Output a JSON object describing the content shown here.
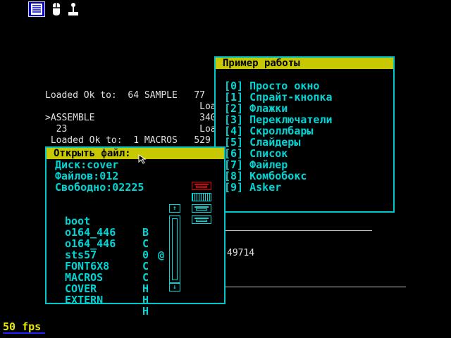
{
  "top_icons": [
    "menu-icon",
    "mouse-icon",
    "joystick-icon"
  ],
  "console": {
    "lines": [
      {
        "text": "Loaded Ok to:  64 SAMPLE   77",
        "row": 0
      },
      {
        "text": "                            Loa",
        "row": 1
      },
      {
        "text": ">ASSEMBLE                   340",
        "row": 2
      },
      {
        "text": "  23                        Loa",
        "row": 3
      },
      {
        "text": " Loaded Ok to:  1 MACROS   529",
        "row": 4
      }
    ],
    "number": "49714"
  },
  "example_window": {
    "title": "Пример работы",
    "items": [
      "[0] Просто окно",
      "[1] Спрайт-кнопка",
      "[2] Флажки",
      "[3] Переключатели",
      "[4] Скроллбары",
      "[5] Слайдеры",
      "[6] Список",
      "[7] Файлер",
      "[8] Комбобокс",
      "[9] Asker"
    ]
  },
  "open_file_window": {
    "title": "Открыть файл:",
    "disk": "Диск:cover",
    "files_count": "Файлов:012",
    "free": "Свободно:02225",
    "files": [
      {
        "name": "boot",
        "attr": "B"
      },
      {
        "name": "o164_446",
        "attr": "C"
      },
      {
        "name": "o164_446",
        "attr": "0"
      },
      {
        "name": "sts57",
        "attr": "C"
      },
      {
        "name": "FONT6X8",
        "attr": "C"
      },
      {
        "name": "MACROS",
        "attr": "H"
      },
      {
        "name": "COVER",
        "attr": "H"
      },
      {
        "name": "EXTERN",
        "attr": "H"
      }
    ],
    "selected_marker": "@",
    "scroll_up": "↑",
    "scroll_down": "↓",
    "colors": {
      "title_bg": "#c8c800",
      "border": "#00c8c8",
      "text": "#00d4d4",
      "active_icon": "#e00000"
    }
  },
  "fps": "50 fps"
}
